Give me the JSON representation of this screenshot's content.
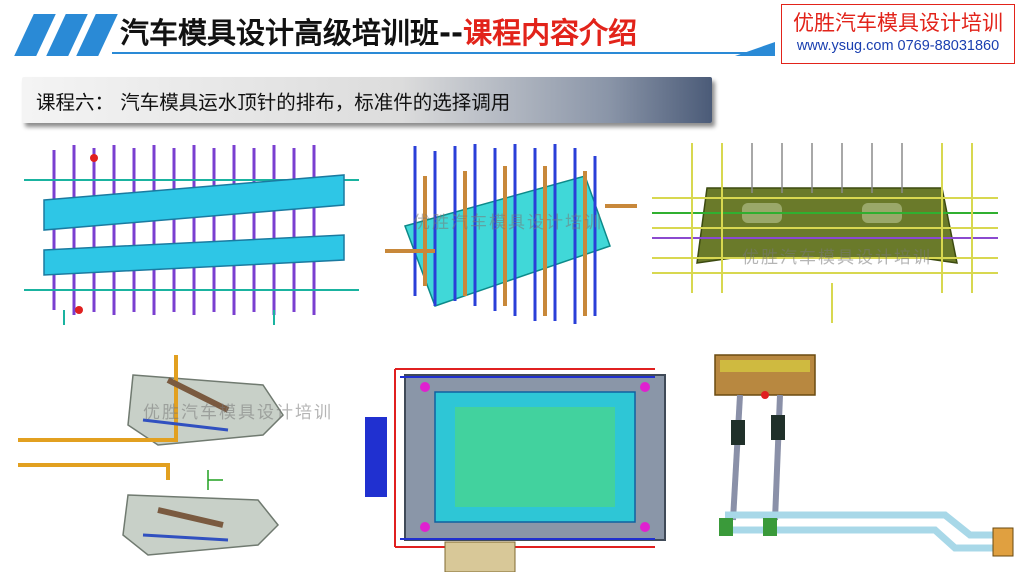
{
  "header": {
    "title_main": "汽车模具设计高级培训班--",
    "title_accent": "课程内容介绍",
    "brand_name": "优胜汽车模具设计培训",
    "brand_contact": "www.ysug.com 0769-88031860",
    "colors": {
      "accent_blue": "#2a8ad6",
      "accent_red": "#e2231a"
    }
  },
  "lesson": {
    "text": "课程六： 汽车模具运水顶针的排布，标准件的选择调用"
  },
  "images": {
    "watermark": "优胜汽车模具设计培训"
  }
}
